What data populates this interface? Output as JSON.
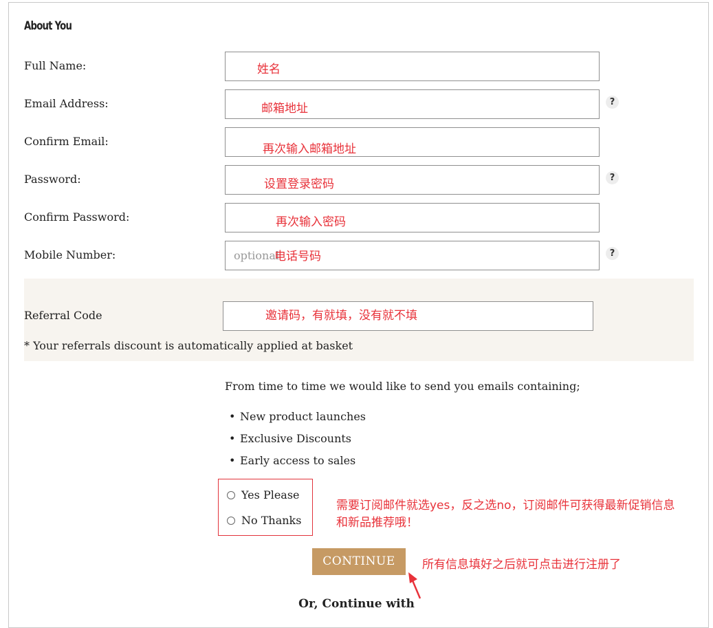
{
  "section_title": "About You",
  "fields": {
    "full_name": {
      "label": "Full Name:",
      "annotation": "姓名"
    },
    "email": {
      "label": "Email Address:",
      "annotation": "邮箱地址",
      "help": "?"
    },
    "confirm_email": {
      "label": "Confirm Email:",
      "annotation": "再次输入邮箱地址"
    },
    "password": {
      "label": "Password:",
      "annotation": "设置登录密码",
      "help": "?"
    },
    "confirm_password": {
      "label": "Confirm Password:",
      "annotation": "再次输入密码"
    },
    "mobile": {
      "label": "Mobile Number:",
      "placeholder": "optional",
      "annotation": "电话号码",
      "help": "?"
    }
  },
  "referral": {
    "label": "Referral Code",
    "annotation": "邀请码，有就填，没有就不填",
    "note": "* Your referrals discount is automatically applied at basket"
  },
  "marketing": {
    "intro": "From time to time we would like to send you emails containing;",
    "bullets": [
      "New product launches",
      "Exclusive Discounts",
      "Early access to sales"
    ],
    "options": [
      "Yes Please",
      "No Thanks"
    ],
    "annotation_line1": "需要订阅邮件就选yes，反之选no，订阅邮件可获得最新促销信息",
    "annotation_line2": "和新品推荐哦！"
  },
  "continue_button": "CONTINUE",
  "continue_annotation": "所有信息填好之后就可点击进行注册了",
  "or_continue_with": "Or, Continue with",
  "colors": {
    "annotation": "#e8323a",
    "button": "#c69a64",
    "referral_bg": "#f7f4ef"
  }
}
